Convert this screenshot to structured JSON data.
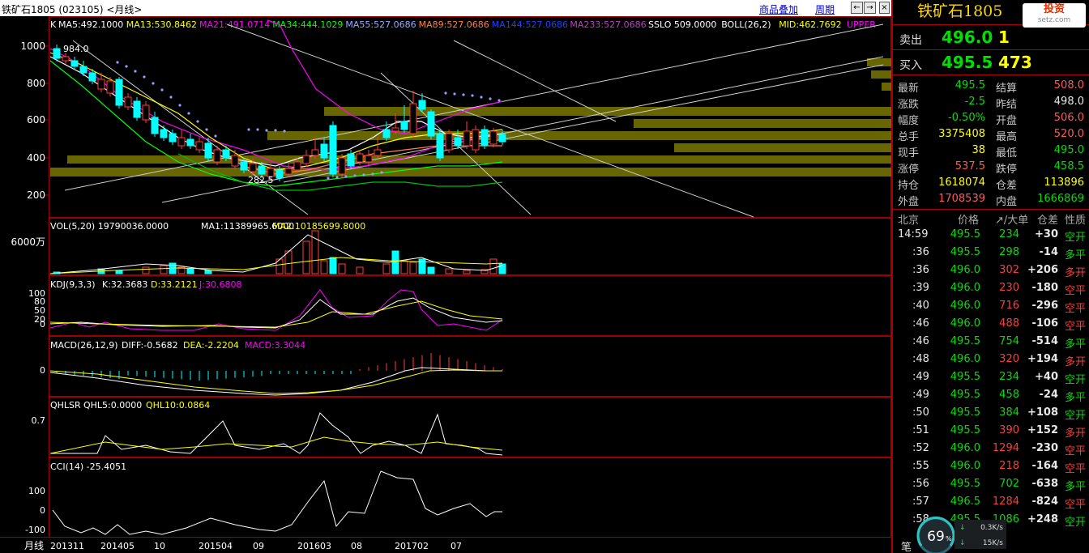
{
  "window": {
    "title": "铁矿石1805 (023105) <月线>",
    "links": [
      "商品叠加",
      "周期"
    ],
    "buttons": [
      "←",
      "→",
      "□",
      "×"
    ]
  },
  "main_panel": {
    "label": "K",
    "indicators": [
      {
        "text": "MA5:492.1000",
        "color": "#ffffff"
      },
      {
        "text": "MA13:530.8462",
        "color": "#ffff00"
      },
      {
        "text": "MA21:491.0714",
        "color": "#ff00ff"
      },
      {
        "text": "MA34:444.1029",
        "color": "#00ff00"
      },
      {
        "text": "MA55:527.0686",
        "color": "#9aa8ff"
      },
      {
        "text": "MA89:527.0686",
        "color": "#ff8040"
      },
      {
        "text": "MA144:527.0686",
        "color": "#2040ff"
      },
      {
        "text": "MA233:527.0686",
        "color": "#c040c0"
      },
      {
        "text": "SSLO 509.0000",
        "color": "#ffffff"
      },
      {
        "text": "BOLL(26,2)",
        "color": "#ffffff"
      },
      {
        "text": "MID:462.7692",
        "color": "#ffff00"
      },
      {
        "text": "UPPER",
        "color": "#ff00ff"
      }
    ],
    "y_ticks": [
      "1000",
      "800",
      "600",
      "400",
      "200"
    ],
    "high_label": "984.0",
    "low_label": "282.5"
  },
  "vol_panel": {
    "label": "VOL(5,20) 19790036.0000",
    "ma1": "MA1:11389965.6000",
    "ma2": "MA2:10185699.8000",
    "y_tick": "6000万"
  },
  "kdj_panel": {
    "label": "KDJ(9,3,3)",
    "k": "K:32.3683",
    "d": "D:33.2121",
    "j": "J:30.6808",
    "y_ticks": [
      "100",
      "80",
      "50",
      "20",
      "0"
    ]
  },
  "macd_panel": {
    "label": "MACD(26,12,9)",
    "diff": "DIFF:-0.5682",
    "dea": "DEA:-2.2204",
    "macd": "MACD:3.3044",
    "y_tick": "0"
  },
  "qhlsr_panel": {
    "label": "QHLSR",
    "qhl5": "QHL5:0.0000",
    "qhl10": "QHL10:0.0864",
    "y_tick": "0.7"
  },
  "cci_panel": {
    "label": "CCI(14) -25.4051",
    "y_ticks": [
      "100",
      "0",
      "-100"
    ]
  },
  "x_axis": {
    "period": "月线",
    "labels": [
      "201311",
      "201405",
      "10",
      "201504",
      "09",
      "201603",
      "08",
      "201702",
      "07"
    ]
  },
  "side": {
    "name": "铁矿石1805",
    "logo": "投资",
    "logo_sub": "setz.com",
    "ask": {
      "label": "卖出",
      "price": "496.0",
      "vol": "1"
    },
    "bid": {
      "label": "买入",
      "price": "495.5",
      "vol": "473"
    },
    "stats": [
      [
        "最新",
        "495.5",
        "结算",
        "508.0"
      ],
      [
        "涨跌",
        "-2.5",
        "昨结",
        "498.0"
      ],
      [
        "幅度",
        "-0.50%",
        "开盘",
        "506.0"
      ],
      [
        "总手",
        "3375408",
        "最高",
        "520.0"
      ],
      [
        "现手",
        "38",
        "最低",
        "495.0"
      ],
      [
        "涨停",
        "537.5",
        "跌停",
        "458.5"
      ],
      [
        "持仓",
        "1618074",
        "仓差",
        "113896"
      ],
      [
        "外盘",
        "1708539",
        "内盘",
        "1666869"
      ]
    ],
    "ticks_header": [
      "北京",
      "价格",
      "↗/大单",
      "仓差",
      "性质"
    ],
    "ticks": [
      [
        "14:59",
        "495.5",
        "234",
        "+30",
        "空开"
      ],
      [
        ":36",
        "495.5",
        "298",
        "-14",
        "多平"
      ],
      [
        ":36",
        "496.0",
        "302",
        "+206",
        "多开"
      ],
      [
        ":39",
        "496.0",
        "230",
        "-180",
        "空平"
      ],
      [
        ":40",
        "496.0",
        "716",
        "-296",
        "空平"
      ],
      [
        ":46",
        "496.0",
        "488",
        "-106",
        "空平"
      ],
      [
        ":46",
        "495.5",
        "754",
        "-514",
        "多平"
      ],
      [
        ":48",
        "496.0",
        "320",
        "+194",
        "多开"
      ],
      [
        ":49",
        "495.5",
        "234",
        "+40",
        "空开"
      ],
      [
        ":49",
        "495.5",
        "458",
        "-24",
        "多平"
      ],
      [
        ":50",
        "495.5",
        "384",
        "+108",
        "空开"
      ],
      [
        ":51",
        "495.5",
        "390",
        "+152",
        "多开"
      ],
      [
        ":52",
        "496.0",
        "1294",
        "-230",
        "空平"
      ],
      [
        ":55",
        "496.0",
        "218",
        "-164",
        "空平"
      ],
      [
        ":56",
        "495.5",
        "702",
        "-638",
        "多平"
      ],
      [
        ":57",
        "496.5",
        "1284",
        "-824",
        "空平"
      ],
      [
        ":58",
        "495.5",
        "1086",
        "+248",
        "空开"
      ]
    ],
    "gauge": {
      "percent": 69,
      "up": "0.3K/s",
      "down": "15K/s"
    },
    "footer": "笔"
  }
}
